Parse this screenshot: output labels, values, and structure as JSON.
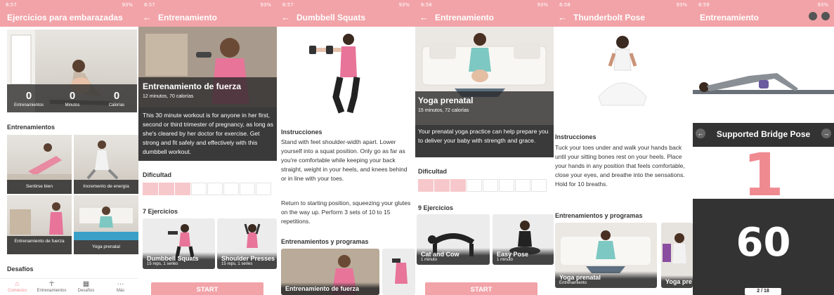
{
  "status": {
    "times": [
      "6:57",
      "6:57",
      "6:57",
      "6:58",
      "6:58",
      "6:59"
    ],
    "right": "93%"
  },
  "screen1": {
    "title": "Ejercicios para embarazadas",
    "stats": [
      {
        "value": "0",
        "label": "Entrenamientos"
      },
      {
        "value": "0",
        "label": "Minutos"
      },
      {
        "value": "0",
        "label": "Calorías"
      }
    ],
    "trainings_heading": "Entrenamientos",
    "tiles": [
      "Sentirse bien",
      "Incremento de energía",
      "Entrenamiento de fuerza",
      "Yoga prenatal"
    ],
    "challenges_heading": "Desafíos",
    "nav": [
      {
        "label": "Comienzo",
        "icon": "home-icon"
      },
      {
        "label": "Entrenamientos",
        "icon": "figure-icon"
      },
      {
        "label": "Desafíos",
        "icon": "calendar-icon"
      },
      {
        "label": "Más",
        "icon": "more-icon"
      }
    ]
  },
  "screen2": {
    "appbar": "Entrenamiento",
    "hero_title": "Entrenamiento de fuerza",
    "hero_subtitle": "12 minutos, 70 calorías",
    "description": "This 30 minute workout is for anyone in her first, second or third trimester of pregnancy, as long as she's cleared by her doctor for exercise. Get strong and fit safely and effectively with this dumbbell workout.",
    "difficulty_heading": "Dificultad",
    "difficulty_level": 3,
    "difficulty_max": 8,
    "exercises_heading": "7 Ejercicios",
    "cards": [
      {
        "title": "Dumbbell Squats",
        "sub": "15 reps, 1 series"
      },
      {
        "title": "Shoulder Presses",
        "sub": "15 reps, 1 series"
      }
    ],
    "start": "START"
  },
  "screen3": {
    "appbar": "Dumbbell Squats",
    "instructions_heading": "Instrucciones",
    "p1": "Stand with feet shoulder-width apart. Lower yourself into a squat position. Only go as far as you're comfortable while keeping your back straight, weight in your heels, and knees behind or in line with your toes.",
    "p2": "Return to starting position, squeezing your glutes on the way up. Perform 3 sets of 10 to 15 repetitions.",
    "programs_heading": "Entrenamientos y programas",
    "card_title": "Entrenamiento de fuerza"
  },
  "screen4": {
    "appbar": "Entrenamiento",
    "hero_title": "Yoga prenatal",
    "hero_subtitle": "15 minutos, 72 calorías",
    "description": "Your prenatal yoga practice can help prepare you to deliver your baby with strength and grace.",
    "difficulty_heading": "Dificultad",
    "difficulty_level": 3,
    "difficulty_max": 8,
    "exercises_heading": "9 Ejercicios",
    "cards": [
      {
        "title": "Cat and Cow",
        "sub": "1 minuto"
      },
      {
        "title": "Easy Pose",
        "sub": "1 minuto"
      }
    ],
    "start": "START"
  },
  "screen5": {
    "appbar": "Thunderbolt Pose",
    "instructions_heading": "Instrucciones",
    "text": "Tuck your toes under and walk your hands back until your sitting bones rest on your heels. Place your hands in any position that feels comfortable, close your eyes, and breathe into the sensations. Hold for 10 breaths.",
    "programs_heading": "Entrenamientos y programas",
    "cards": [
      {
        "title": "Yoga prenatal",
        "sub": "Entrenamiento"
      },
      {
        "title": "Yoga pre",
        "sub": ""
      }
    ]
  },
  "screen6": {
    "appbar": "Entrenamiento",
    "pose_title": "Supported Bridge Pose",
    "pose_number": "1",
    "timer": "60",
    "progress": "2 / 18"
  },
  "colors": {
    "pink": "#f2a3a8",
    "pink_text": "#f08a91",
    "dark": "#333333"
  }
}
